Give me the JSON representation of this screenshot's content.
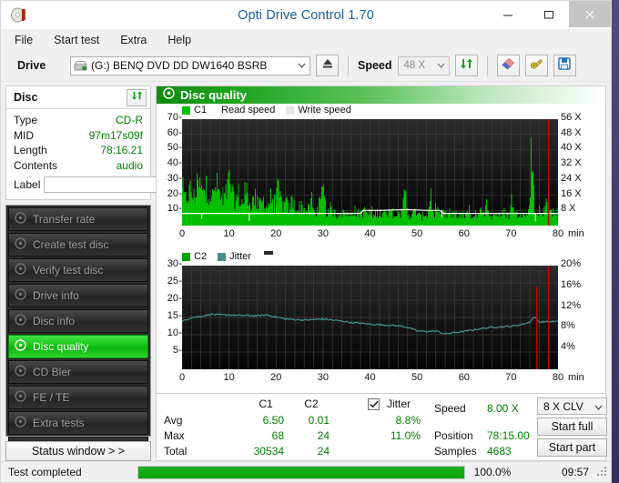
{
  "window": {
    "title": "Opti Drive Control 1.70",
    "icon": "disc-icon",
    "minimize": "minimize-icon",
    "maximize": "maximize-icon",
    "close": "close-icon"
  },
  "menu": [
    "File",
    "Start test",
    "Extra",
    "Help"
  ],
  "toolbar": {
    "drive_label": "Drive",
    "drive_value": "(G:)  BENQ DVD DD DW1640 BSRB",
    "drive_icon": "drive-icon",
    "eject_icon": "eject-icon",
    "speed_label": "Speed",
    "speed_value": "48 X",
    "refresh_icon": "refresh-icon",
    "erase_icon": "erase-icon",
    "tools_icon": "tools-icon",
    "save_icon": "save-icon"
  },
  "disc_panel": {
    "title": "Disc",
    "refresh_icon": "refresh-icon",
    "rows": [
      {
        "key": "Type",
        "value": "CD-R"
      },
      {
        "key": "MID",
        "value": "97m17s09f"
      },
      {
        "key": "Length",
        "value": "78:16.21"
      },
      {
        "key": "Contents",
        "value": "audio"
      }
    ],
    "label_key": "Label",
    "label_value": "",
    "label_placeholder": "",
    "label_icon": "cd-icon"
  },
  "nav": {
    "items": [
      {
        "label": "Transfer rate",
        "active": false
      },
      {
        "label": "Create test disc",
        "active": false
      },
      {
        "label": "Verify test disc",
        "active": false
      },
      {
        "label": "Drive info",
        "active": false
      },
      {
        "label": "Disc info",
        "active": false
      },
      {
        "label": "Disc quality",
        "active": true
      },
      {
        "label": "CD Bler",
        "active": false
      },
      {
        "label": "FE / TE",
        "active": false
      },
      {
        "label": "Extra tests",
        "active": false
      }
    ],
    "status_button": "Status window > >"
  },
  "quality": {
    "header": "Disc quality",
    "header_icon": "disc-quality-icon"
  },
  "stats": {
    "col_c1": "C1",
    "col_c2": "C2",
    "col_jitter": "Jitter",
    "jitter_checked": true,
    "row_avg": "Avg",
    "row_max": "Max",
    "row_total": "Total",
    "avg_c1": "6.50",
    "avg_c2": "0.01",
    "avg_jitter": "8.8%",
    "max_c1": "68",
    "max_c2": "24",
    "max_jitter": "11.0%",
    "total_c1": "30534",
    "total_c2": "24",
    "speed_label": "Speed",
    "speed_value": "8.00 X",
    "position_label": "Position",
    "position_value": "78:15.00",
    "samples_label": "Samples",
    "samples_value": "4683",
    "clv_value": "8 X CLV",
    "start_full": "Start full",
    "start_part": "Start part"
  },
  "statusbar": {
    "text": "Test completed",
    "progress_percent": "100.0%",
    "progress_value": 100,
    "clock": "09:57",
    "grip_icon": "resize-grip-icon"
  },
  "colors": {
    "c1": "#00c000",
    "c2": "#00a000",
    "jitter": "#4a8e90",
    "read_speed": "#ffffff",
    "write_speed": "#e6e6e6",
    "marker": "#cc0000",
    "accent_green": "#008000"
  },
  "chart_data": [
    {
      "type": "bar",
      "id": "c1-chart",
      "title": "C1 / Read speed",
      "xlabel": "min",
      "ylabel": "C1",
      "xlim": [
        0,
        80
      ],
      "ylim": [
        0,
        70
      ],
      "yticks": [
        10,
        20,
        30,
        40,
        50,
        60,
        70
      ],
      "xticks": [
        0,
        10,
        20,
        30,
        40,
        50,
        60,
        70,
        80
      ],
      "right_axis_label": "X",
      "right_ticks": [
        "8 X",
        "16 X",
        "24 X",
        "32 X",
        "40 X",
        "48 X",
        "56 X"
      ],
      "right_ylim": [
        0,
        60
      ],
      "grid": true,
      "legend": [
        "C1",
        "Read speed",
        "Write speed"
      ],
      "legend_position": "top-left",
      "series": [
        {
          "name": "C1",
          "color": "#00c000",
          "x": [
            0,
            0.6,
            1.2,
            1.8,
            2.4,
            3,
            3.6,
            4.2,
            4.8,
            5.4,
            6,
            6.6,
            7.2,
            7.8,
            8.4,
            9,
            9.6,
            10.2,
            10.8,
            11.4,
            12,
            12.6,
            13.2,
            13.8,
            14.4,
            15,
            15.6,
            16.2,
            16.8,
            17.4,
            18,
            18.6,
            19.2,
            19.8,
            20.4,
            21,
            21.6,
            22.2,
            22.8,
            23.4,
            24,
            24.6,
            25.2,
            25.8,
            26.4,
            27,
            27.6,
            28.2,
            28.8,
            29.4,
            30,
            30.6,
            31.2,
            31.8,
            32.4,
            33,
            33.6,
            34.2,
            34.8,
            35.4,
            36,
            36.6,
            37.2,
            37.8,
            38.4,
            39,
            39.6,
            40.2,
            40.8,
            41.4,
            42,
            42.6,
            43.2,
            43.8,
            44.4,
            45,
            45.6,
            46.2,
            46.8,
            47.4,
            48,
            48.6,
            49.2,
            49.8,
            50.4,
            51,
            51.6,
            52.2,
            52.8,
            53.4,
            54,
            54.6,
            55.2,
            55.8,
            56.4,
            57,
            57.6,
            58.2,
            58.8,
            59.4,
            60,
            60.6,
            61.2,
            61.8,
            62.4,
            63,
            63.6,
            64.2,
            64.8,
            65.4,
            66,
            66.6,
            67.2,
            67.8,
            68.4,
            69,
            69.6,
            70.2,
            70.8,
            71.4,
            72,
            72.6,
            73.2,
            73.8,
            74.4,
            75,
            75.6,
            76.2,
            76.8,
            77.4,
            78
          ],
          "values": [
            29,
            22,
            26,
            31,
            24,
            28,
            35,
            30,
            26,
            33,
            27,
            24,
            36,
            29,
            22,
            25,
            30,
            41,
            24,
            21,
            27,
            19,
            22,
            31,
            18,
            20,
            24,
            17,
            19,
            22,
            16,
            20,
            18,
            15,
            30,
            22,
            17,
            19,
            14,
            22,
            16,
            13,
            18,
            15,
            12,
            14,
            19,
            11,
            13,
            16,
            32,
            12,
            10,
            14,
            11,
            9,
            13,
            10,
            12,
            8,
            11,
            14,
            9,
            12,
            10,
            13,
            9,
            11,
            8,
            12,
            10,
            9,
            11,
            8,
            13,
            10,
            7,
            12,
            9,
            32,
            11,
            8,
            10,
            13,
            9,
            7,
            11,
            8,
            24,
            10,
            12,
            9,
            8,
            11,
            7,
            10,
            9,
            12,
            8,
            10,
            7,
            9,
            11,
            8,
            10,
            7,
            12,
            9,
            23,
            10,
            8,
            11,
            9,
            7,
            12,
            10,
            8,
            24,
            11,
            9,
            13,
            10,
            8,
            12,
            68,
            11,
            9,
            14,
            10,
            19,
            12
          ]
        },
        {
          "name": "Read speed",
          "color": "#ffffff",
          "unit": "X",
          "description": "white stepped line held at 8 X for most of the scan, rising to about 10 X between 38 and 55 min",
          "x": [
            0,
            4,
            4.4,
            14,
            14.4,
            38,
            38.5,
            42,
            48,
            52,
            55,
            55.5,
            78
          ],
          "values": [
            8,
            8,
            8,
            8,
            8,
            8,
            10,
            10,
            10.5,
            10,
            10,
            8,
            8
          ]
        }
      ],
      "annotations": [
        {
          "type": "vline",
          "x": 78,
          "color": "#cc0000",
          "label": "end-of-test marker"
        }
      ]
    },
    {
      "type": "line",
      "id": "c2-jitter-chart",
      "title": "C2 / Jitter",
      "xlabel": "min",
      "ylabel": "C2",
      "xlim": [
        0,
        80
      ],
      "ylim": [
        0,
        30
      ],
      "yticks": [
        5,
        10,
        15,
        20,
        25,
        30
      ],
      "xticks": [
        0,
        10,
        20,
        30,
        40,
        50,
        60,
        70,
        80
      ],
      "right_ticks": [
        "4%",
        "8%",
        "12%",
        "16%",
        "20%"
      ],
      "right_ylim": [
        0,
        20
      ],
      "grid": true,
      "legend": [
        "C2",
        "Jitter"
      ],
      "legend_position": "top-left",
      "series": [
        {
          "name": "C2",
          "color": "#00a000",
          "description": "virtually zero across the whole scan (total 24 errors)",
          "x": [
            0,
            80
          ],
          "values": [
            0,
            0
          ]
        },
        {
          "name": "Jitter",
          "color": "#4a8e90",
          "unit": "%",
          "x": [
            0,
            2,
            4,
            6,
            8,
            10,
            12,
            14,
            16,
            18,
            20,
            22,
            24,
            26,
            28,
            30,
            32,
            34,
            36,
            38,
            40,
            42,
            44,
            46,
            48,
            50,
            52,
            54,
            56,
            58,
            60,
            62,
            64,
            66,
            68,
            70,
            72,
            74,
            75,
            76,
            77,
            78
          ],
          "values": [
            9.2,
            10.0,
            10.2,
            10.6,
            10.5,
            10.5,
            10.4,
            10.4,
            10.3,
            10.5,
            10.1,
            9.7,
            9.6,
            9.5,
            9.6,
            9.7,
            9.5,
            9.3,
            9.0,
            8.9,
            8.7,
            8.6,
            8.5,
            8.4,
            8.1,
            7.4,
            7.3,
            7.4,
            6.8,
            7.1,
            7.3,
            7.6,
            7.9,
            8.1,
            8.2,
            8.3,
            8.6,
            9.1,
            10.2,
            9.1,
            9.2,
            9.2
          ]
        }
      ],
      "annotations": [
        {
          "type": "vline",
          "x": 75.5,
          "color": "#cc0000",
          "label": "marker"
        },
        {
          "type": "vline",
          "x": 78,
          "color": "#cc0000",
          "label": "end-of-test marker"
        }
      ]
    }
  ]
}
